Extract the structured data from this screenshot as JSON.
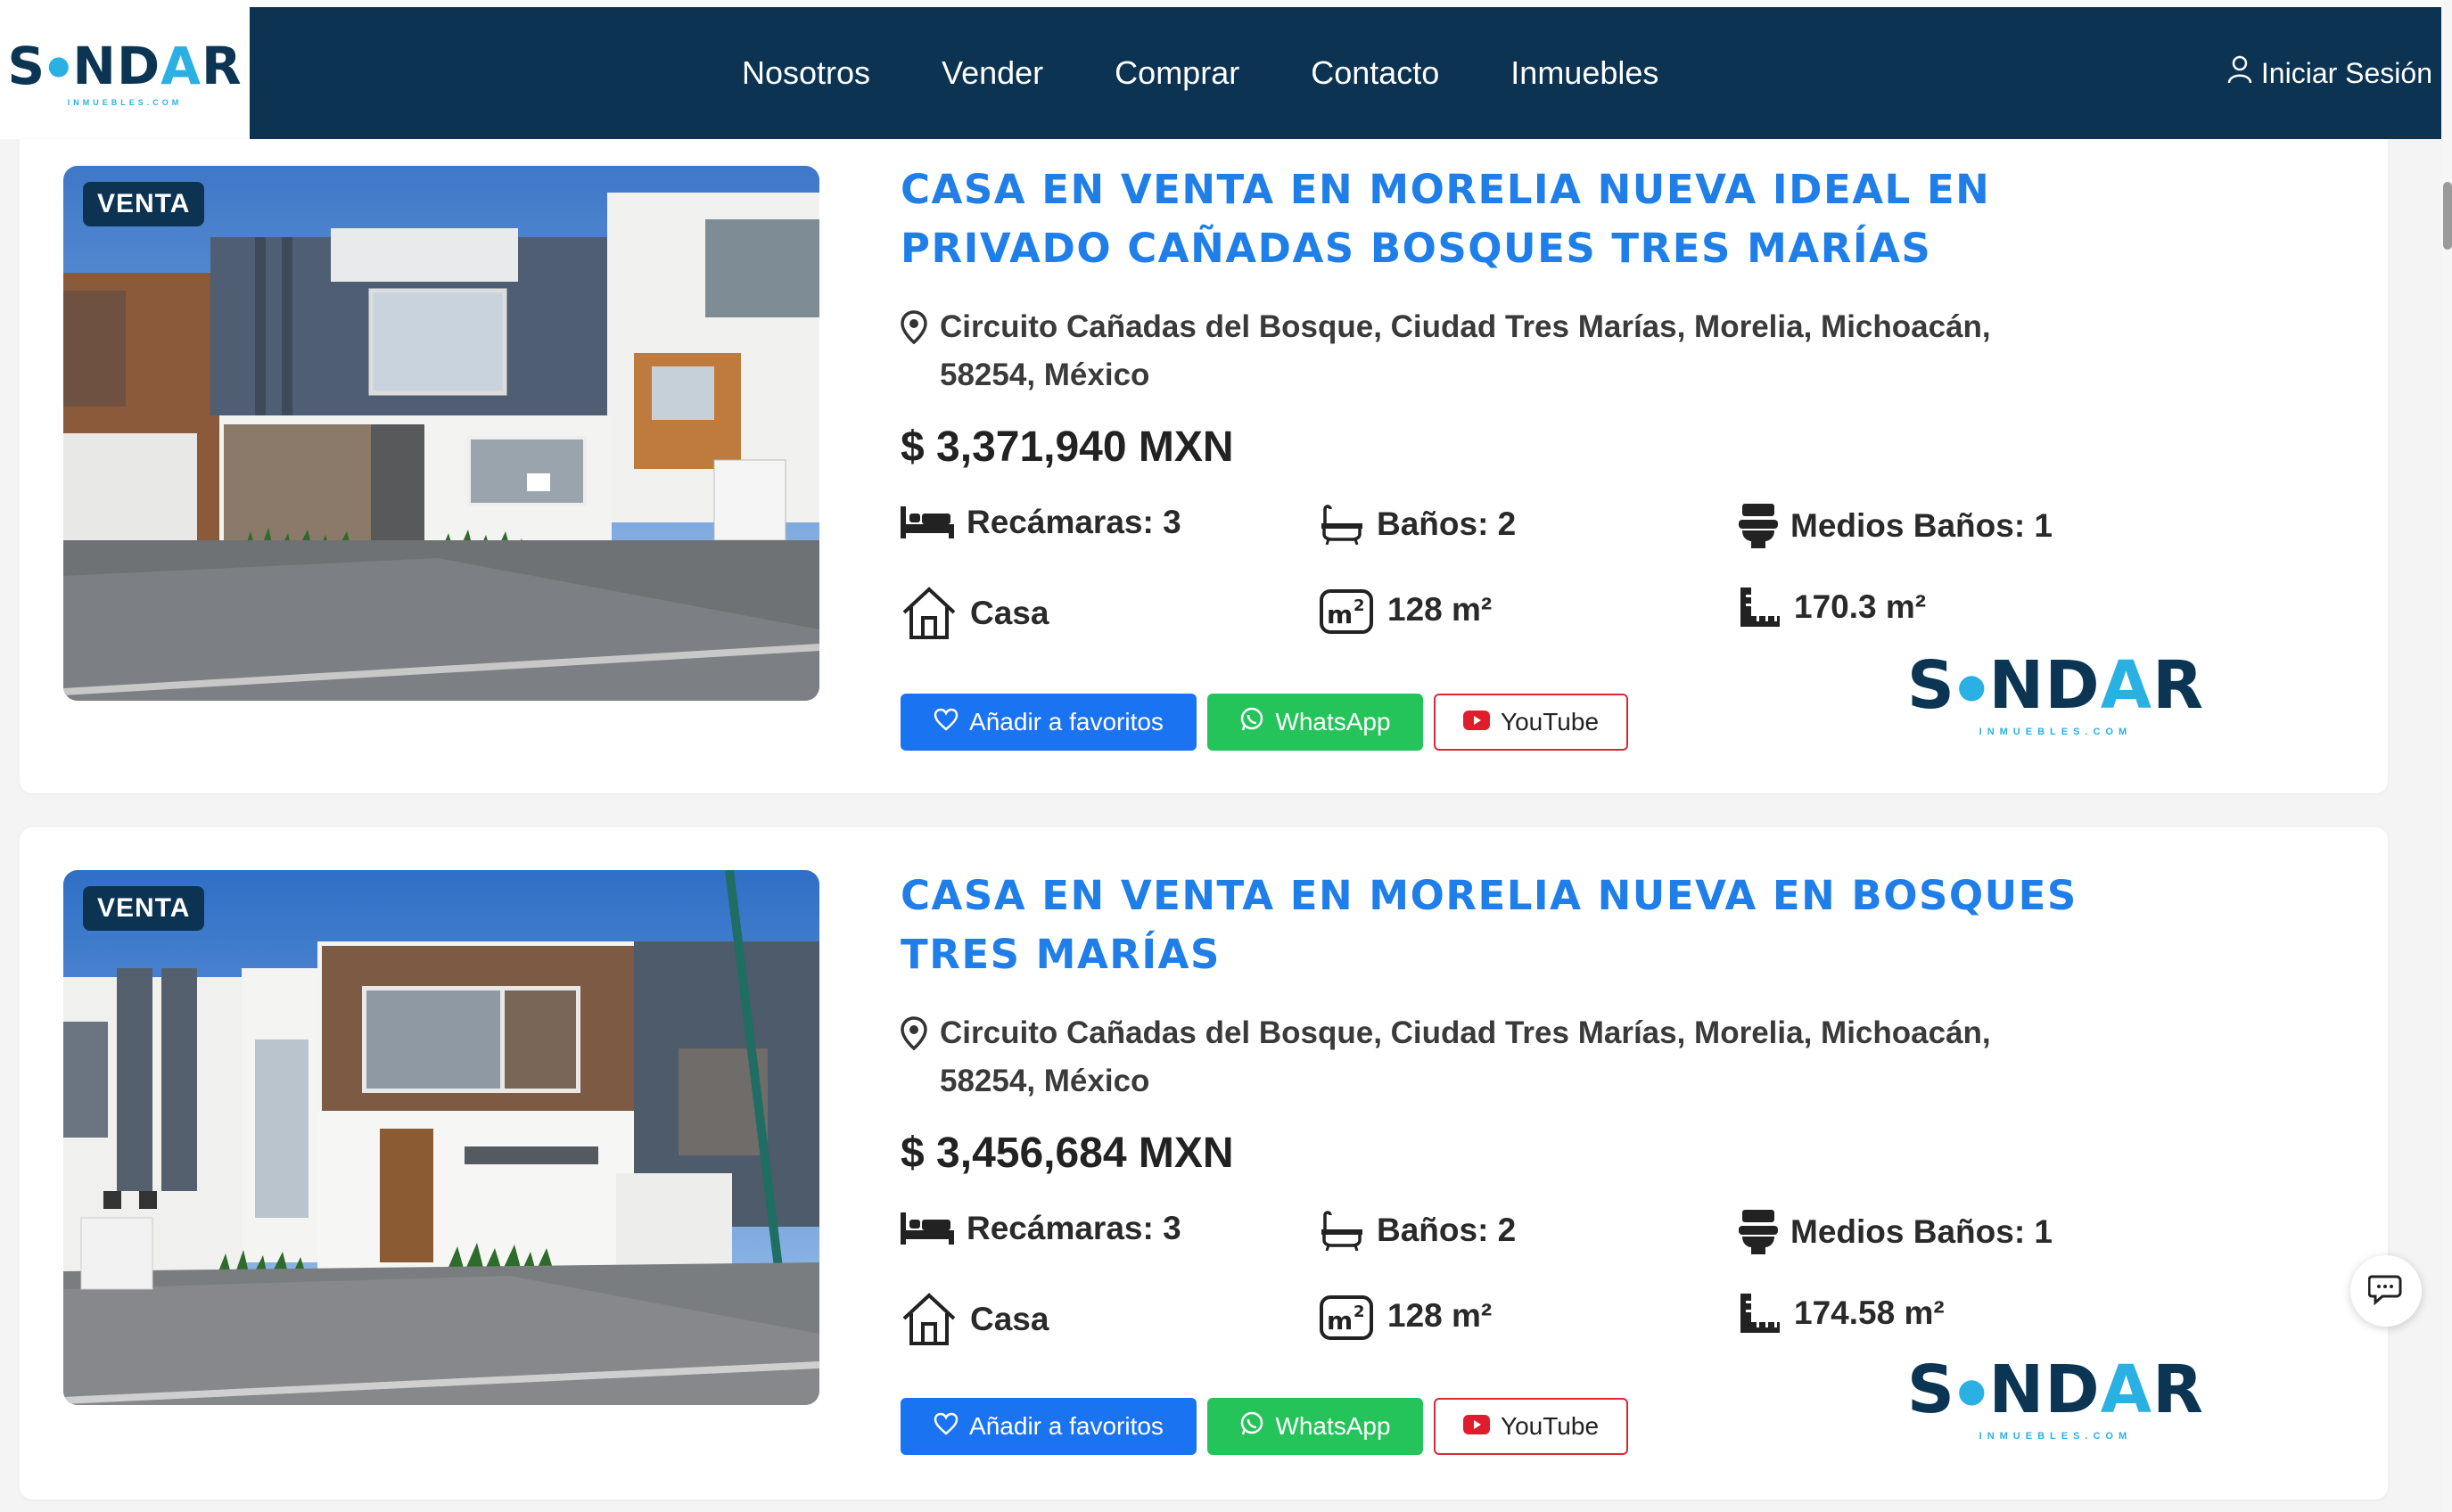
{
  "brand": {
    "name_pre": "S",
    "name_mid": "ND",
    "name_accent": "A",
    "name_post": "R",
    "tagline": "INMUEBLES.COM",
    "colors": {
      "navy": "#0c3352",
      "cyan": "#2bb0e3",
      "link_blue": "#1f7ee8"
    }
  },
  "nav": {
    "items": [
      "Nosotros",
      "Vender",
      "Comprar",
      "Contacto",
      "Inmuebles"
    ],
    "login_label": "Iniciar Sesión",
    "login_icon": "user-icon"
  },
  "listings": [
    {
      "badge": "VENTA",
      "title": "CASA EN VENTA EN MORELIA NUEVA IDEAL EN PRIVADO CAÑADAS BOSQUES TRES MARÍAS",
      "address": "Circuito Cañadas del Bosque, Ciudad Tres Marías, Morelia, Michoacán, 58254, México",
      "price": "$ 3,371,940 MXN",
      "bedrooms": "Recámaras: 3",
      "bathrooms": "Baños: 2",
      "half_baths": "Medios Baños: 1",
      "type": "Casa",
      "built_area": "128 m²",
      "lot_area": "170.3 m²"
    },
    {
      "badge": "VENTA",
      "title": "CASA EN VENTA EN MORELIA NUEVA EN BOSQUES TRES MARÍAS",
      "address": "Circuito Cañadas del Bosque, Ciudad Tres Marías, Morelia, Michoacán, 58254, México",
      "price": "$ 3,456,684 MXN",
      "bedrooms": "Recámaras: 3",
      "bathrooms": "Baños: 2",
      "half_baths": "Medios Baños: 1",
      "type": "Casa",
      "built_area": "128 m²",
      "lot_area": "174.58 m²"
    }
  ],
  "buttons": {
    "favorite": "Añadir a favoritos",
    "whatsapp": "WhatsApp",
    "youtube": "YouTube"
  },
  "icons": {
    "pin": "map-pin-icon",
    "bed": "bed-icon",
    "bath": "bathtub-icon",
    "toilet": "toilet-icon",
    "house": "house-icon",
    "area": "m2-icon",
    "ruler": "ruler-icon",
    "heart": "heart-icon",
    "whatsapp": "whatsapp-icon",
    "youtube": "youtube-icon",
    "chat": "chat-icon"
  }
}
